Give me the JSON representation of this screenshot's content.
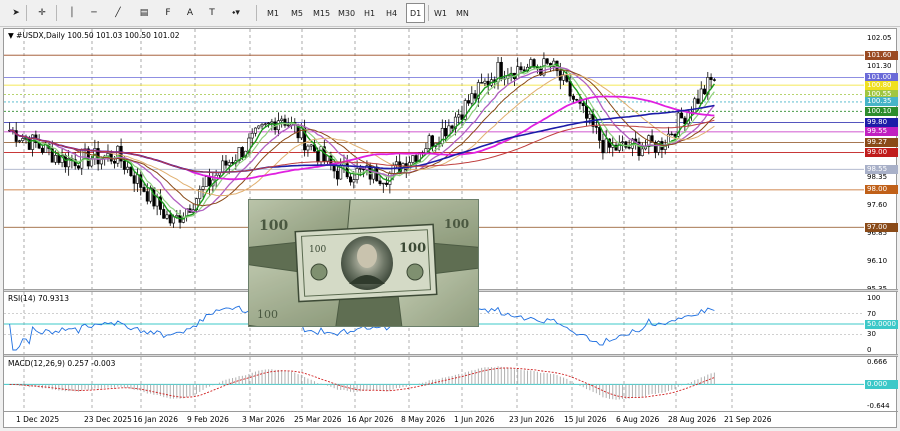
{
  "toolbar": {
    "tools": [
      {
        "name": "cursor-icon",
        "glyph": "➤"
      },
      {
        "name": "crosshair-icon",
        "glyph": "✛"
      },
      {
        "name": "vertical-line-icon",
        "glyph": "│"
      },
      {
        "name": "horizontal-line-icon",
        "glyph": "─"
      },
      {
        "name": "trendline-icon",
        "glyph": "╱"
      },
      {
        "name": "equidistant-channel-icon",
        "glyph": "▤"
      },
      {
        "name": "fibonacci-icon",
        "glyph": "F"
      },
      {
        "name": "text-icon",
        "glyph": "A"
      },
      {
        "name": "text-label-icon",
        "glyph": "T"
      },
      {
        "name": "shapes-icon",
        "glyph": "⬩▾"
      }
    ],
    "timeframes": [
      "M1",
      "M5",
      "M15",
      "M30",
      "H1",
      "H4",
      "D1",
      "W1",
      "MN"
    ],
    "active_timeframe": "D1"
  },
  "main_pane": {
    "title": "#USDX,Daily  100.50 101.03 100.50 101.02",
    "axis_labels": [
      "102.05",
      "101.30",
      "100.55",
      "99.80",
      "99.05",
      "98.35",
      "97.60",
      "96.85",
      "96.10",
      "95.35"
    ],
    "level_tags": [
      {
        "value": "101.60",
        "color": "#9a4a22"
      },
      {
        "value": "101.00",
        "color": "#6a6ad8"
      },
      {
        "value": "100.80",
        "color": "#f0e020"
      },
      {
        "value": "100.55",
        "color": "#a0c640"
      },
      {
        "value": "100.35",
        "color": "#46b4c8"
      },
      {
        "value": "100.10",
        "color": "#2c8c2c"
      },
      {
        "value": "99.80",
        "color": "#1c1ca8"
      },
      {
        "value": "99.55",
        "color": "#c020c0"
      },
      {
        "value": "99.27",
        "color": "#8a4a18"
      },
      {
        "value": "99.00",
        "color": "#c01c1c"
      },
      {
        "value": "98.55",
        "color": "#a8b0c8"
      },
      {
        "value": "98.00",
        "color": "#c06018"
      },
      {
        "value": "97.00",
        "color": "#8a4a18"
      }
    ]
  },
  "rsi_pane": {
    "title": "RSI(14) 70.9313",
    "axis_labels": [
      "100",
      "70",
      "30",
      "0"
    ],
    "level_tag": "50.0000"
  },
  "macd_pane": {
    "title": "MACD(12,26,9) 0.257 -0.003",
    "axis_labels": [
      "0.666",
      "-0.644"
    ],
    "level_tag": "0.000"
  },
  "dates": [
    "1 Dec 2025",
    "23 Dec 2025",
    "16 Jan 2026",
    "9 Feb 2026",
    "3 Mar 2026",
    "25 Mar 2026",
    "16 Apr 2026",
    "8 May 2026",
    "1 Jun 2026",
    "23 Jun 2026",
    "15 Jul 2026",
    "6 Aug 2026",
    "28 Aug 2026",
    "21 Sep 2026"
  ],
  "chart_data": {
    "type": "candlestick",
    "symbol": "#USDX",
    "timeframe": "Daily",
    "ohlc_last": {
      "open": 100.5,
      "high": 101.03,
      "low": 100.5,
      "close": 101.02
    },
    "ylim": [
      95.35,
      102.3
    ],
    "horizontal_levels": [
      101.6,
      101.0,
      100.8,
      100.55,
      100.35,
      100.1,
      99.8,
      99.55,
      99.27,
      99.0,
      98.55,
      98.0,
      97.0
    ],
    "x": [
      "1 Dec 2025",
      "23 Dec 2025",
      "16 Jan 2026",
      "9 Feb 2026",
      "3 Mar 2026",
      "25 Mar 2026",
      "16 Apr 2026",
      "8 May 2026",
      "1 Jun 2026",
      "23 Jun 2026",
      "15 Jul 2026",
      "6 Aug 2026",
      "28 Aug 2026",
      "21 Sep 2026"
    ],
    "close_approx": [
      99.6,
      98.8,
      98.9,
      97.1,
      98.7,
      100.0,
      98.5,
      98.4,
      99.6,
      101.2,
      101.3,
      99.1,
      99.2,
      101.0
    ],
    "rsi": {
      "name": "RSI(14)",
      "last": 70.9313,
      "levels": [
        30,
        50,
        70
      ],
      "ylim": [
        0,
        100
      ]
    },
    "macd": {
      "name": "MACD(12,26,9)",
      "main": 0.257,
      "signal": -0.003,
      "ylim": [
        -0.644,
        0.666
      ]
    }
  }
}
